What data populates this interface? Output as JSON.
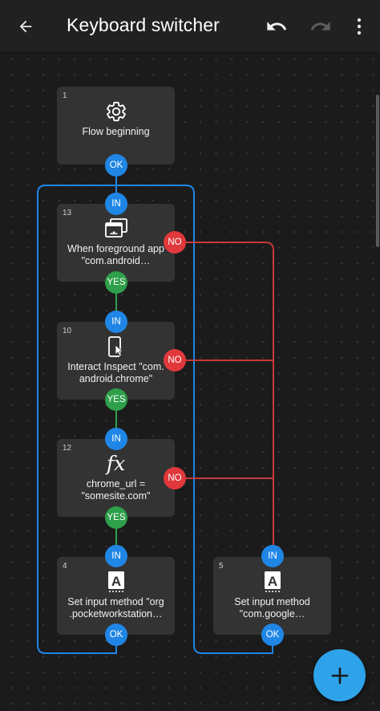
{
  "header": {
    "title": "Keyboard switcher",
    "back_icon": "arrow-back-icon",
    "undo_icon": "undo-icon",
    "redo_icon": "redo-icon",
    "more_icon": "more-vert-icon"
  },
  "colors": {
    "in_port": "#1f86e6",
    "yes_port": "#2e9f4a",
    "no_port": "#e0383b",
    "fab": "#2ea3ea"
  },
  "blocks": [
    {
      "id": "1",
      "icon": "gear-icon",
      "label": "Flow beginning",
      "ports": {
        "ok": "OK"
      }
    },
    {
      "id": "13",
      "icon": "app-windows-icon",
      "label": "When foreground app\n\"com.android…",
      "ports": {
        "in": "IN",
        "yes": "YES",
        "no": "NO"
      }
    },
    {
      "id": "10",
      "icon": "touch-inspect-icon",
      "label": "Interact Inspect \"com.\nandroid.chrome\"",
      "ports": {
        "in": "IN",
        "yes": "YES",
        "no": "NO"
      }
    },
    {
      "id": "12",
      "icon": "function-icon",
      "label": "chrome_url =\n\"somesite.com\"",
      "ports": {
        "in": "IN",
        "yes": "YES",
        "no": "NO"
      }
    },
    {
      "id": "4",
      "icon": "keyboard-a-icon",
      "label": "Set input method \"org\n.pocketworkstation…",
      "ports": {
        "in": "IN",
        "ok": "OK"
      }
    },
    {
      "id": "5",
      "icon": "keyboard-a-icon",
      "label": "Set input method\n\"com.google…",
      "ports": {
        "in": "IN",
        "ok": "OK"
      }
    }
  ],
  "fab": {
    "icon": "plus-icon"
  }
}
